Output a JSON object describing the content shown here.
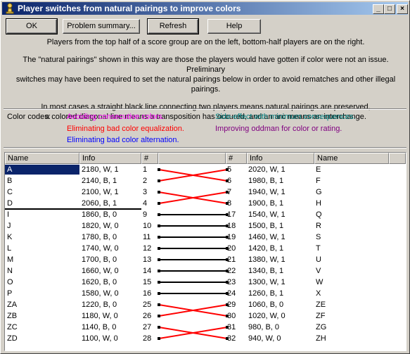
{
  "window": {
    "title": "Player switches from natural pairings to improve colors",
    "buttons": {
      "minimize": "_",
      "maximize": "□",
      "close": "×"
    }
  },
  "toolbar": {
    "ok": "OK",
    "problem_summary": "Problem summary...",
    "refresh": "Refresh",
    "help": "Help"
  },
  "info": {
    "line1": "Players from the top half of a score group are on the left, bottom-half players are on the right.",
    "line2": "The \"natural pairings\" shown in this way are those the players would have gotten if color were not an issue. Preliminary",
    "line3": "switches may have been required to set the natural pairings below in order to avoid rematches and other illegal pairings.",
    "line4": "In most cases a straight black line connecting two players means natural pairings are preserved,",
    "line5": "a colored diagonal line means a transposition has occured, and an arc means an interchange."
  },
  "color_codes": {
    "label": "Color codes:",
    "items": [
      {
        "text": "Avoiding consecutive colors.",
        "color": "#ff00ff"
      },
      {
        "text": "Side-effect with minimum consequences.",
        "color": "#008080"
      },
      {
        "text": "Eliminating bad color equalization.",
        "color": "#ff0000"
      },
      {
        "text": "Improving oddman for color or rating.",
        "color": "#800080"
      },
      {
        "text": "Eliminating bad color alternation.",
        "color": "#0000ff"
      }
    ]
  },
  "table": {
    "headers": [
      "Name",
      "Info",
      "#",
      "#",
      "Info",
      "Name"
    ],
    "rows": [
      {
        "ln": "A",
        "li": "2180, W, 1",
        "lnum": "1",
        "rnum": "5",
        "ri": "2020, W, 1",
        "rn": "E",
        "link": "cross",
        "color": "#ff0000"
      },
      {
        "ln": "B",
        "li": "2140, B, 1",
        "lnum": "2",
        "rnum": "6",
        "ri": "1980, B, 1",
        "rn": "F",
        "link": "cross",
        "color": "#ff0000"
      },
      {
        "ln": "C",
        "li": "2100, W, 1",
        "lnum": "3",
        "rnum": "7",
        "ri": "1940, W, 1",
        "rn": "G",
        "link": "cross",
        "color": "#ff0000"
      },
      {
        "ln": "D",
        "li": "2060, B, 1",
        "lnum": "4",
        "rnum": "8",
        "ri": "1900, B, 1",
        "rn": "H",
        "link": "cross",
        "color": "#ff0000"
      },
      {
        "ln": "I",
        "li": "1860, B, 0",
        "lnum": "9",
        "rnum": "17",
        "ri": "1540, W, 1",
        "rn": "Q",
        "link": "straight",
        "color": "#000000"
      },
      {
        "ln": "J",
        "li": "1820, W, 0",
        "lnum": "10",
        "rnum": "18",
        "ri": "1500, B, 1",
        "rn": "R",
        "link": "straight",
        "color": "#000000"
      },
      {
        "ln": "K",
        "li": "1780, B, 0",
        "lnum": "11",
        "rnum": "19",
        "ri": "1460, W, 1",
        "rn": "S",
        "link": "straight",
        "color": "#000000"
      },
      {
        "ln": "L",
        "li": "1740, W, 0",
        "lnum": "12",
        "rnum": "20",
        "ri": "1420, B, 1",
        "rn": "T",
        "link": "straight",
        "color": "#000000"
      },
      {
        "ln": "M",
        "li": "1700, B, 0",
        "lnum": "13",
        "rnum": "21",
        "ri": "1380, W, 1",
        "rn": "U",
        "link": "straight",
        "color": "#000000"
      },
      {
        "ln": "N",
        "li": "1660, W, 0",
        "lnum": "14",
        "rnum": "22",
        "ri": "1340, B, 1",
        "rn": "V",
        "link": "straight",
        "color": "#000000"
      },
      {
        "ln": "O",
        "li": "1620, B, 0",
        "lnum": "15",
        "rnum": "23",
        "ri": "1300, W, 1",
        "rn": "W",
        "link": "straight",
        "color": "#000000"
      },
      {
        "ln": "P",
        "li": "1580, W, 0",
        "lnum": "16",
        "rnum": "24",
        "ri": "1260, B, 1",
        "rn": "X",
        "link": "straight",
        "color": "#000000"
      },
      {
        "ln": "ZA",
        "li": "1220, B, 0",
        "lnum": "25",
        "rnum": "29",
        "ri": "1060, B, 0",
        "rn": "ZE",
        "link": "cross",
        "color": "#ff0000"
      },
      {
        "ln": "ZB",
        "li": "1180, W, 0",
        "lnum": "26",
        "rnum": "30",
        "ri": "1020, W, 0",
        "rn": "ZF",
        "link": "cross",
        "color": "#ff0000"
      },
      {
        "ln": "ZC",
        "li": "1140, B, 0",
        "lnum": "27",
        "rnum": "31",
        "ri": "980, B, 0",
        "rn": "ZG",
        "link": "cross",
        "color": "#ff0000"
      },
      {
        "ln": "ZD",
        "li": "1100, W, 0",
        "lnum": "28",
        "rnum": "32",
        "ri": "940, W, 0",
        "rn": "ZH",
        "link": "cross",
        "color": "#ff0000"
      }
    ]
  }
}
